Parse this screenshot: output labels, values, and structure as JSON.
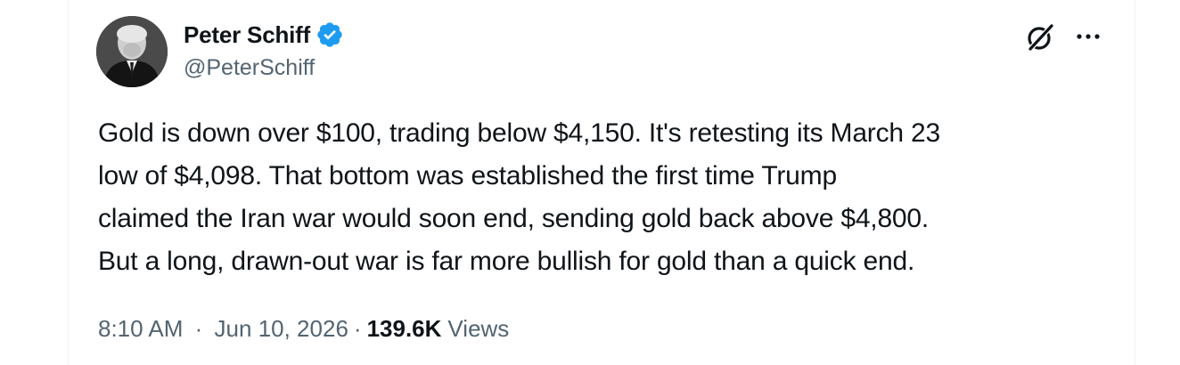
{
  "author": {
    "display_name": "Peter Schiff",
    "handle": "@PeterSchiff",
    "verified": true,
    "verified_color": "#1d9bf0"
  },
  "icons": {
    "avatar": "profile-photo",
    "verified": "verified-badge-icon",
    "grok": "grok-icon",
    "more": "more-options-icon"
  },
  "tweet": {
    "lines": [
      "Gold is down over $100, trading below $4,150. It's retesting its March 23",
      "low of $4,098. That bottom was established the first time Trump",
      "claimed the Iran war would soon end, sending gold back above $4,800.",
      "But a long, drawn-out war is far more bullish for gold than a quick end."
    ]
  },
  "meta": {
    "time": "8:10 AM",
    "separator": "·",
    "date": "Jun 10, 2026",
    "views_count": "139.6K",
    "views_label": "Views"
  },
  "colors": {
    "text_primary": "#0f1419",
    "text_secondary": "#536471",
    "border": "#eff3f4"
  }
}
